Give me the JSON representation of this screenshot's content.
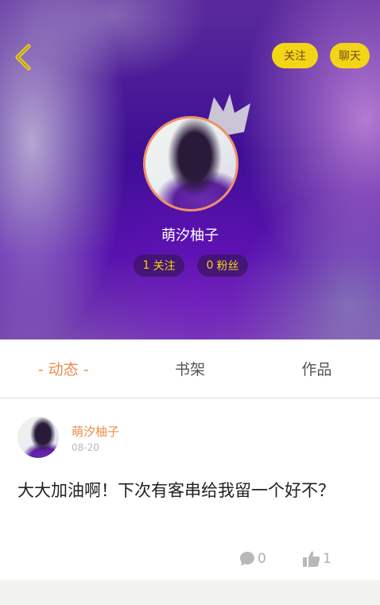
{
  "header": {
    "follow_label": "关注",
    "chat_label": "聊天",
    "username": "萌汐柚子",
    "following_count": "1",
    "following_label": "关注",
    "fans_count": "0",
    "fans_label": "粉丝",
    "icons": {
      "back": "chevron-left-icon",
      "crown": "crown-icon"
    },
    "colors": {
      "pill_bg": "#f3d518",
      "avatar_ring": "#f0906a"
    }
  },
  "tabs": [
    {
      "label": "- 动态 -",
      "active": true
    },
    {
      "label": "书架",
      "active": false
    },
    {
      "label": "作品",
      "active": false
    }
  ],
  "post": {
    "author": "萌汐柚子",
    "date": "08-20",
    "text": "大大加油啊！下次有客串给我留一个好不？",
    "comment_count": "0",
    "like_count": "1",
    "icons": {
      "comment": "comment-icon",
      "like": "thumbs-up-icon"
    }
  },
  "colors": {
    "accent": "#ef8a4a"
  }
}
